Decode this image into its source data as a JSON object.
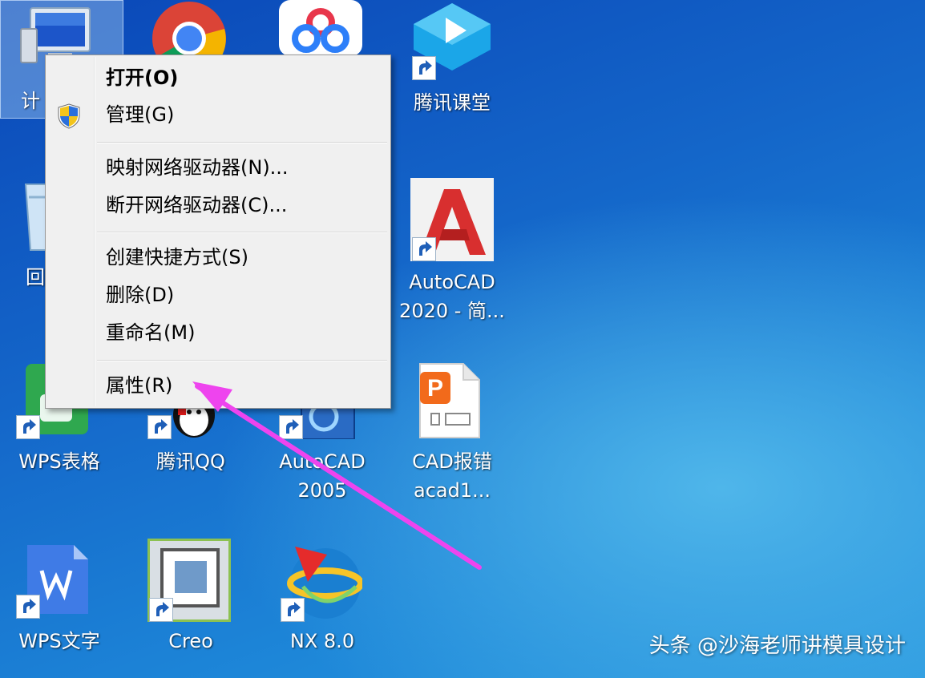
{
  "desktop": {
    "icons": {
      "computer": {
        "label": "计",
        "icon": "computer-icon"
      },
      "chrome": {
        "label": "",
        "icon": "chrome-icon"
      },
      "baidu_netdisk": {
        "label": "",
        "icon": "baidu-netdisk-icon"
      },
      "tencent_classroom": {
        "label": "腾讯课堂",
        "icon": "tencent-classroom-icon"
      },
      "recycle_bin": {
        "label": "回",
        "icon": "recycle-bin-icon"
      },
      "autocad2020": {
        "label_line1": "AutoCAD",
        "label_line2": "2020 - 简...",
        "icon": "autocad-icon"
      },
      "wps_sheet": {
        "label": "WPS表格",
        "icon": "wps-sheet-icon"
      },
      "qq": {
        "label": "腾讯QQ",
        "icon": "qq-penguin-icon"
      },
      "autocad2005": {
        "label_line1": "AutoCAD",
        "label_line2": "2005",
        "icon": "autocad-icon"
      },
      "cad_error": {
        "label_line1": "CAD报错",
        "label_line2": "acad1...",
        "icon": "document-icon"
      },
      "wps_writer": {
        "label": "WPS文字",
        "icon": "wps-writer-icon"
      },
      "creo": {
        "label": "Creo",
        "icon": "creo-icon"
      },
      "nx": {
        "label": "NX 8.0",
        "icon": "nx-icon"
      }
    }
  },
  "context_menu": {
    "items": {
      "open": "打开(O)",
      "manage": "管理(G)",
      "map_drive": "映射网络驱动器(N)...",
      "disconnect_drive": "断开网络驱动器(C)...",
      "create_shortcut": "创建快捷方式(S)",
      "delete": "删除(D)",
      "rename": "重命名(M)",
      "properties": "属性(R)"
    }
  },
  "watermark": "头条 @沙海老师讲模具设计",
  "colors": {
    "desktop_top": "#0a47b8",
    "desktop_bottom": "#2c9ae0",
    "menu_bg": "#f0f0f0",
    "annotation_arrow": "#ee44ee"
  }
}
